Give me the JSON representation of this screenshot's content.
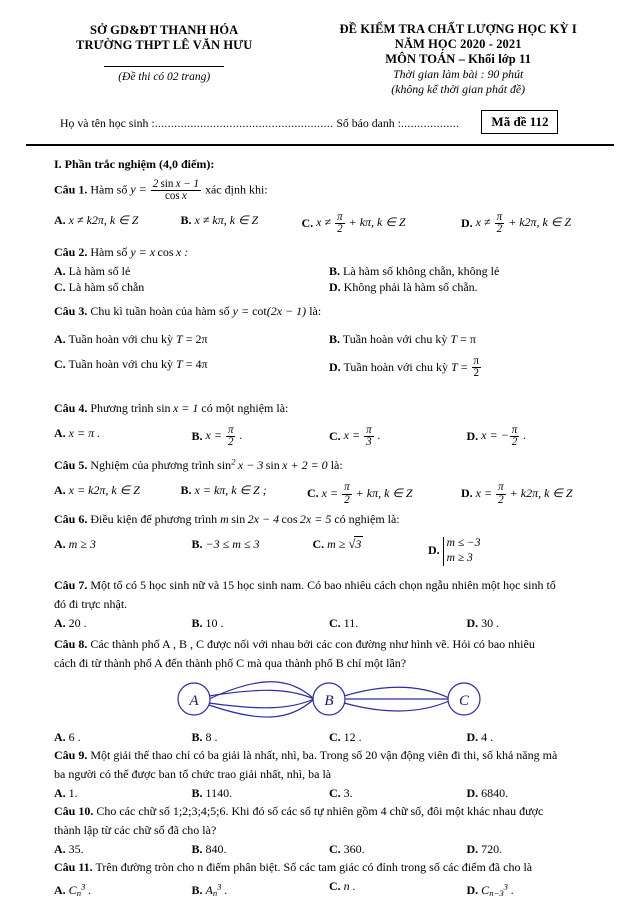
{
  "header": {
    "left_line1": "SỞ GD&ĐT THANH HÓA",
    "left_line2": "TRƯỜNG THPT LÊ VĂN HƯU",
    "pages_note": "(Đề thi có 02 trang)",
    "right_line1": "ĐỀ KIỂM TRA CHẤT LƯỢNG HỌC KỲ I",
    "right_line2": "NĂM HỌC 2020 - 2021",
    "right_line3": "MÔN TOÁN – Khối lớp 11",
    "right_line4": "Thời gian làm bài : 90 phút",
    "right_line5": "(không kể thời gian phát đề)"
  },
  "student_info": {
    "name_label": "Họ và tên học sinh :",
    "name_dots": ".......................................................",
    "id_label": "Số báo danh :",
    "id_dots": "..................",
    "exam_code": "Mã đề 112"
  },
  "section": {
    "title": "I. Phần trắc nghiệm (4,0 điểm):"
  },
  "questions": [
    {
      "num": "Câu 1.",
      "stem_before": "Hàm số",
      "stem_after": "xác định khi:",
      "options": [
        {
          "label": "A.",
          "text": "x ≠ k2π, k ∈ Z"
        },
        {
          "label": "B.",
          "text": "x ≠ kπ, k ∈ Z"
        },
        {
          "label": "C.",
          "text": "x ≠ π/2 + kπ, k ∈ Z"
        },
        {
          "label": "D.",
          "text": "x ≠ π/2 + k2π, k ∈ Z"
        }
      ]
    },
    {
      "num": "Câu 2.",
      "stem_before": "Hàm số",
      "stem_formula": "y = x cos x :",
      "options": [
        {
          "label": "A.",
          "text": "Là hàm số lẻ"
        },
        {
          "label": "B.",
          "text": "Là hàm số không chẵn, không lẻ"
        },
        {
          "label": "C.",
          "text": "Là hàm số chẵn"
        },
        {
          "label": "D.",
          "text": "Không phải là hàm số chẵn."
        }
      ]
    },
    {
      "num": "Câu 3.",
      "stem_before": "Chu kì tuần hoàn của hàm số",
      "stem_formula": "y = cot(2x − 1)",
      "stem_after": "là:",
      "options": [
        {
          "label": "A.",
          "text": "Tuần hoàn với chu kỳ T = 2π"
        },
        {
          "label": "B.",
          "text": "Tuần hoàn với chu kỳ T = π"
        },
        {
          "label": "C.",
          "text": "Tuần hoàn với chu kỳ T = 4π"
        },
        {
          "label": "D.",
          "text": "Tuần hoàn với chu kỳ T = π/2"
        }
      ]
    },
    {
      "num": "Câu 4.",
      "stem_before": "Phương trình",
      "stem_formula": "sin x = 1",
      "stem_after": "có một nghiệm là:",
      "options": [
        {
          "label": "A.",
          "text": "x = π ."
        },
        {
          "label": "B.",
          "text": "x = π/2 ."
        },
        {
          "label": "C.",
          "text": "x = π/3 ."
        },
        {
          "label": "D.",
          "text": "x = −π/2 ."
        }
      ]
    },
    {
      "num": "Câu 5.",
      "stem_before": "Nghiệm của phương trình",
      "stem_formula": "sin² x − 3 sin x + 2 = 0",
      "stem_after": "là:",
      "options": [
        {
          "label": "A.",
          "text": "x = k2π, k ∈ Z"
        },
        {
          "label": "B.",
          "text": "x = kπ, k ∈ Z ;"
        },
        {
          "label": "C.",
          "text": "x = π/2 + kπ, k ∈ Z"
        },
        {
          "label": "D.",
          "text": "x = π/2 + k2π, k ∈ Z"
        }
      ]
    },
    {
      "num": "Câu 6.",
      "stem_before": "Điều kiện để phương trình",
      "stem_formula": "m sin 2x − 4 cos 2x = 5",
      "stem_after": "có nghiệm là:",
      "options": [
        {
          "label": "A.",
          "text": "m ≥ 3"
        },
        {
          "label": "B.",
          "text": "−3 ≤ m ≤ 3"
        },
        {
          "label": "C.",
          "text": "m ≥ √3"
        },
        {
          "label": "D.",
          "text": "m ≤ −3 ; m ≥ 3"
        }
      ],
      "brace_row1": "m ≤ −3",
      "brace_row2": "m ≥ 3"
    },
    {
      "num": "Câu 7.",
      "stem_line1": "Một tổ có 5 học sinh nữ và 15 học sinh nam. Có bao nhiêu cách chọn ngẫu nhiên một học sinh tổ",
      "stem_line2": "đó đi trực nhật.",
      "options": [
        {
          "label": "A.",
          "text": "20 ."
        },
        {
          "label": "B.",
          "text": "10 ."
        },
        {
          "label": "C.",
          "text": "11."
        },
        {
          "label": "D.",
          "text": "30 ."
        }
      ]
    },
    {
      "num": "Câu 8.",
      "stem_line1": "Các thành phố A , B , C được nối với nhau bởi các con đường như hình vẽ. Hỏi có bao nhiêu",
      "stem_line2": "cách đi từ thành phố A đến thành phố C mà qua thành phố B chỉ một lần?",
      "options": [
        {
          "label": "A.",
          "text": "6 ."
        },
        {
          "label": "B.",
          "text": "8 ."
        },
        {
          "label": "C.",
          "text": "12 ."
        },
        {
          "label": "D.",
          "text": "4 ."
        }
      ]
    },
    {
      "num": "Câu 9.",
      "stem_line1": "Một giải thể thao chỉ có ba giải là nhất, nhì, ba. Trong số 20 vận động viên đi thi, số khả năng mà",
      "stem_line2": "ba người có thể được ban tổ chức trao giải nhất, nhì, ba là",
      "options": [
        {
          "label": "A.",
          "text": "1."
        },
        {
          "label": "B.",
          "text": "1140."
        },
        {
          "label": "C.",
          "text": "3."
        },
        {
          "label": "D.",
          "text": "6840."
        }
      ]
    },
    {
      "num": "Câu 10.",
      "stem_line1": "Cho các chữ số 1;2;3;4;5;6. Khi đó số các số tự nhiên gồm 4 chữ số, đôi một khác nhau được",
      "stem_line2": "thành lập từ các chữ số đã cho là?",
      "options": [
        {
          "label": "A.",
          "text": "35."
        },
        {
          "label": "B.",
          "text": "840."
        },
        {
          "label": "C.",
          "text": "360."
        },
        {
          "label": "D.",
          "text": "720."
        }
      ]
    },
    {
      "num": "Câu 11.",
      "stem_line1": "Trên đường tròn cho n điểm phân biệt. Số các tam giác có đỉnh trong số các điểm đã cho là",
      "options": [
        {
          "label": "A.",
          "text": "C_n^3 ."
        },
        {
          "label": "B.",
          "text": "A_n^3 ."
        },
        {
          "label": "C.",
          "text": "n ."
        },
        {
          "label": "D.",
          "text": "C_{n−3}^3 ."
        }
      ]
    }
  ],
  "figure": {
    "node_a": "A",
    "node_b": "B",
    "node_c": "C",
    "edges_ab": 4,
    "edges_bc": 3,
    "stroke_color": "#2b2ba8"
  }
}
